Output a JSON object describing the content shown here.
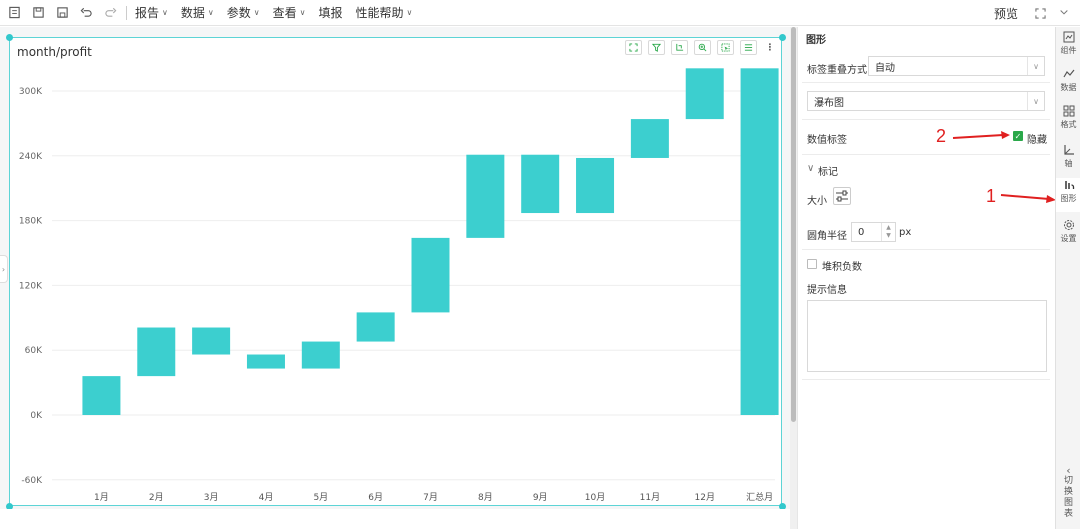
{
  "toolbar": {
    "menus": [
      {
        "label": "报告"
      },
      {
        "label": "数据"
      },
      {
        "label": "参数"
      },
      {
        "label": "查看"
      },
      {
        "label": "填报"
      },
      {
        "label": "性能帮助"
      }
    ],
    "preview_label": "预览"
  },
  "chart_widget": {
    "title": "month/profit",
    "tools": [
      "expand-icon",
      "filter-icon",
      "drill-icon",
      "zoom-icon",
      "select-icon",
      "list-icon",
      "more-icon"
    ]
  },
  "chart_data": {
    "type": "waterfall",
    "title": "month/profit",
    "categories": [
      "1月",
      "2月",
      "3月",
      "4月",
      "5月",
      "6月",
      "7月",
      "8月",
      "9月",
      "10月",
      "11月",
      "12月",
      "汇总月"
    ],
    "bars": [
      {
        "start": 0,
        "end": 36000
      },
      {
        "start": 36000,
        "end": 81000
      },
      {
        "start": 81000,
        "end": 56000
      },
      {
        "start": 56000,
        "end": 43000
      },
      {
        "start": 43000,
        "end": 68000
      },
      {
        "start": 68000,
        "end": 95000
      },
      {
        "start": 95000,
        "end": 164000
      },
      {
        "start": 164000,
        "end": 241000
      },
      {
        "start": 241000,
        "end": 187000
      },
      {
        "start": 187000,
        "end": 238000
      },
      {
        "start": 238000,
        "end": 274000
      },
      {
        "start": 274000,
        "end": 321000
      },
      {
        "start": 0,
        "end": 321000
      }
    ],
    "y_ticks": [
      "300K",
      "240K",
      "180K",
      "120K",
      "60K",
      "0K",
      "-60K"
    ],
    "y_tick_values": [
      300000,
      240000,
      180000,
      120000,
      60000,
      0,
      -60000
    ],
    "ylim": [
      -60000,
      320000
    ],
    "bar_color": "#3ccfcf",
    "grid": true
  },
  "panel": {
    "section_title": "图形",
    "overlap_label": "标签重叠方式",
    "overlap_value": "自动",
    "chart_type_value": "瀑布图",
    "value_label_label": "数值标签",
    "hide_label": "隐藏",
    "mark_label": "标记",
    "size_label": "大小",
    "radius_label": "圆角半径",
    "radius_value": "0",
    "radius_unit": "px",
    "stack_negative_label": "堆积负数",
    "tooltip_label": "提示信息"
  },
  "annotations": {
    "one": "1",
    "two": "2",
    "arrow_color": "#e02020"
  },
  "vtabs": [
    {
      "label": "组件",
      "icon": "component-icon"
    },
    {
      "label": "数据",
      "icon": "data-icon"
    },
    {
      "label": "格式",
      "icon": "format-icon"
    },
    {
      "label": "轴",
      "icon": "axis-icon"
    },
    {
      "label": "图形",
      "icon": "shape-icon"
    },
    {
      "label": "设置",
      "icon": "settings-icon"
    }
  ],
  "switch_chart_label": [
    "切",
    "换",
    "图",
    "表"
  ]
}
